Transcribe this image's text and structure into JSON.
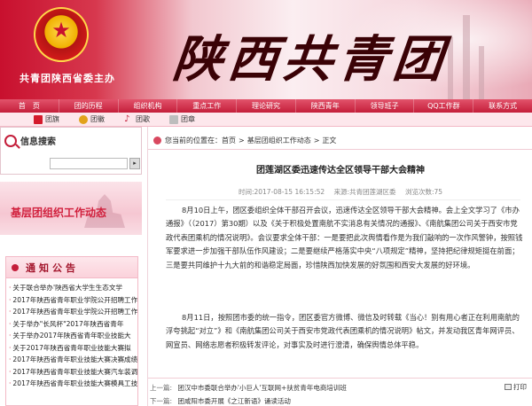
{
  "banner": {
    "org_line": "共青团陕西省委主办",
    "site_title": "陕西共青团",
    "emblem_symbol": "★",
    "colors": {
      "brand_red": "#c41e3a",
      "pink": "#fde7ec"
    }
  },
  "nav": {
    "items": [
      "首　页",
      "团的历程",
      "组织机构",
      "重点工作",
      "理论研究",
      "陕西青年",
      "领导班子",
      "QQ工作群",
      "联系方式"
    ]
  },
  "sublinks": [
    {
      "label": "团旗",
      "icon": "flag-icon",
      "color": "#d41b2c"
    },
    {
      "label": "团徽",
      "icon": "badge-icon",
      "color": "#e2a21b"
    },
    {
      "label": "团歌",
      "icon": "music-icon",
      "color": "#c41e3a"
    },
    {
      "label": "团章",
      "icon": "book-icon",
      "color": "#9a9a9a"
    }
  ],
  "sidebar": {
    "search_title": "信息搜索",
    "search_button": "▸",
    "section_banner": "基层团组织工作动态",
    "notice_title": "通知公告",
    "notices": [
      "关于联合举办'陕西省大学生生态文学",
      "2017年陕西省青年职业学院公开招聘工作",
      "2017年陕西省青年职业学院公开招聘工作",
      "关于举办\"长风杯\"2017年陕西省青年",
      "关于举办2017年陕西省青年职业技能大",
      "关于2017年陕西省青年职业技能大赛拟",
      "2017年陕西省青年职业技能大赛决赛成绩",
      "2017年陕西省青年职业技能大赛汽车装调",
      "2017年陕西省青年职业技能大赛模具工技"
    ]
  },
  "main": {
    "breadcrumb": {
      "prefix": "您当前的位置在：",
      "home": "首页",
      "sep": ">",
      "section": "基层团组织工作动态",
      "current": "正文"
    },
    "title": "团莲湖区委迅速传达全区领导干部大会精神",
    "meta": {
      "time": "时间:2017-08-15 16:15:52",
      "source": "来源:共青团莲湖区委",
      "views": "浏览次数:75"
    },
    "paragraphs": [
      "8月10日上午，团区委组织全体干部召开会议，迅速传达全区领导干部大会精神。会上全文学习了《市办通报》（（2017）第30期）以及《关于积极处置南航不实消息有关情况的通报》、《南航集团公司关于西安市党政代表团乘机的情况说明》。会议要求全体干部：一是要把此次舆情看作是为我们敲响的一次作风警钟，按照钱军要求进一步加强干部队伍作风建设；二是要继续严格落实中央“八项规定”精神，坚持把纪律规矩挺在前面；三是要共同维护十九大前的和谐稳定局面，珍惜陕西加快发展的好氛围和西安大发展的好环境。",
      "8月11日，按照团市委的统一指令，团区委官方微博、微信及时转载《当心！别有用心者正在利用南航的浮夸挑起“对立”》和《南航集团公司关于西安市党政代表团乘机的情况说明》帖文，并发动我区青年网评员、网宣员、网络志愿者积极转发评论，对事实及时进行澄清，确保舆情总体平稳。"
    ],
    "prev_label": "上一篇:",
    "prev_title": "团汉中市委联合举办'小巨人'互联网+扶贫青年电商培训班",
    "next_label": "下一篇:",
    "next_title": "团咸阳市委开展《之江新语》诵读活动",
    "print_label": "打印"
  }
}
